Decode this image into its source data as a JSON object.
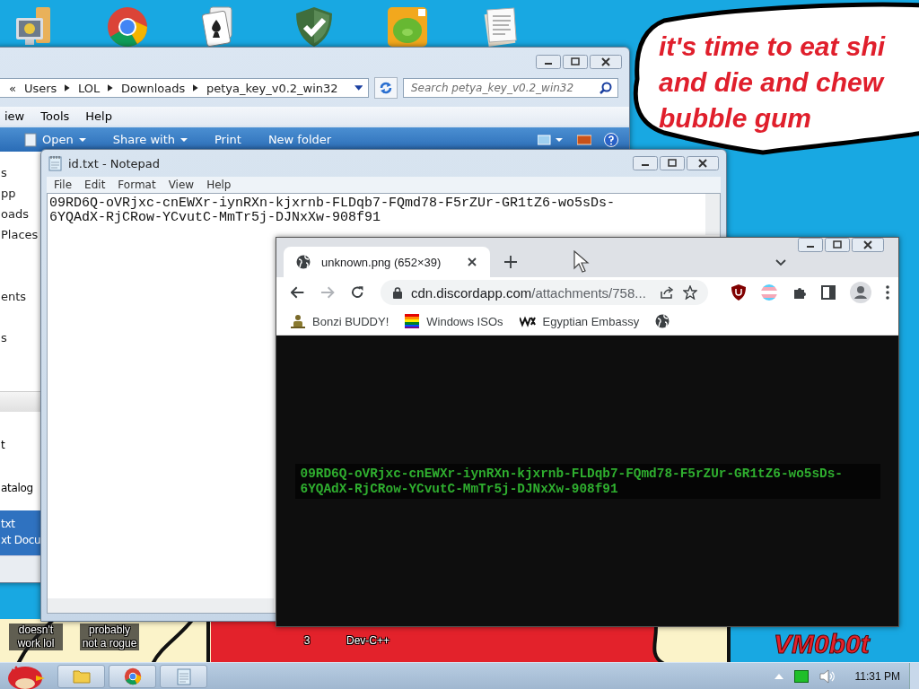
{
  "wallpaper": {
    "bubble_lines": [
      "it's time to eat shi",
      "and die and chew",
      "bubble gum"
    ],
    "signature": "VM0b0t"
  },
  "desktop_icons": [
    {
      "kind": "computer"
    },
    {
      "kind": "browser"
    },
    {
      "kind": "cards"
    },
    {
      "kind": "shield"
    },
    {
      "kind": "game"
    },
    {
      "kind": "document"
    }
  ],
  "desktop_labels": [
    {
      "label": "doesn't work lol"
    },
    {
      "label": "probably not a rogue"
    },
    {
      "label": "3"
    },
    {
      "label": "Dev-C++"
    }
  ],
  "explorer": {
    "breadcrumb": [
      "«",
      "Users",
      "LOL",
      "Downloads",
      "petya_key_v0.2_win32"
    ],
    "search": {
      "placeholder": "Search petya_key_v0.2_win32"
    },
    "menu": [
      "iew",
      "Tools",
      "Help"
    ],
    "toolbar": [
      {
        "label": "Open",
        "menu": true
      },
      {
        "label": "Share with",
        "menu": true
      },
      {
        "label": "Print",
        "menu": false
      },
      {
        "label": "New folder",
        "menu": false
      }
    ],
    "nav_items": [
      "s",
      "pp",
      "oads",
      "Places",
      "ents",
      "s"
    ],
    "files": [
      {
        "name": "t",
        "selected": false
      },
      {
        "name": "atalog",
        "selected": false
      },
      {
        "name": "txt",
        "type": "xt Docu",
        "selected": true
      }
    ]
  },
  "notepad": {
    "title": "id.txt - Notepad",
    "menu": [
      "File",
      "Edit",
      "Format",
      "View",
      "Help"
    ],
    "lines": [
      "09RD6Q-oVRjxc-cnEWXr-iynRXn-kjxrnb-FLDqb7-FQmd78-F5rZUr-GR1tZ6-wo5sDs-",
      "6YQAdX-RjCRow-YCvutC-MmTr5j-DJNxXw-908f91"
    ]
  },
  "browser": {
    "tab": {
      "title": "unknown.png (652×39)",
      "selected": true
    },
    "url_host": "cdn.discordapp.com",
    "url_path": "/attachments/758...",
    "bookmarks": [
      {
        "label": "Bonzi BUDDY!",
        "kind": "buddy"
      },
      {
        "label": "Windows ISOs",
        "kind": "rainbow"
      },
      {
        "label": "Egyptian Embassy",
        "kind": "wix"
      },
      {
        "kind": "globe"
      }
    ],
    "image_lines": [
      "09RD6Q-oVRjxc-cnEWXr-iynRXn-kjxrnb-FLDqb7-FQmd78-F5rZUr-GR1tZ6-wo5sDs-",
      "6YQAdX-RjCRow-YCvutC-MmTr5j-DJNxXw-908f91"
    ]
  },
  "taskbar": {
    "buttons": [
      {
        "kind": "folder"
      },
      {
        "kind": "browser"
      },
      {
        "kind": "notepad"
      }
    ],
    "clock": "11:31 PM"
  }
}
